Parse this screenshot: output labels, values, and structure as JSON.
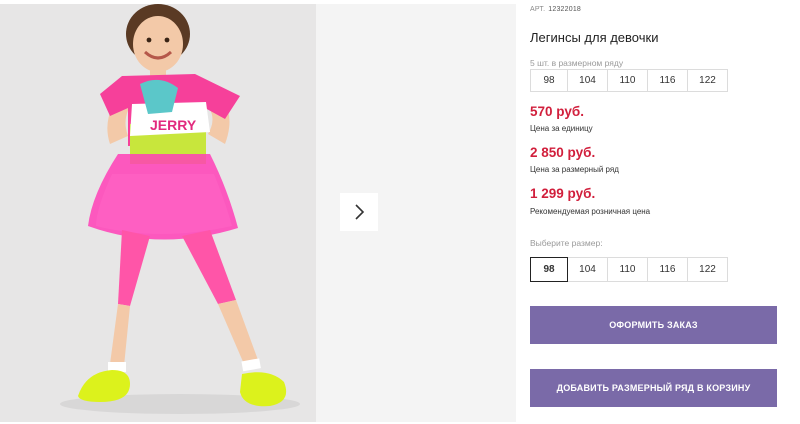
{
  "product": {
    "article_label": "АРТ.",
    "article_number": "12322018",
    "title": "Легинсы для девочки",
    "series_hint": "5 шт. в размерном ряду",
    "series_sizes": [
      "98",
      "104",
      "110",
      "116",
      "122"
    ]
  },
  "prices": {
    "unit_price": "570 руб.",
    "unit_note": "Цена за единицу",
    "series_price": "2 850 руб.",
    "series_note": "Цена за размерный ряд",
    "retail_price": "1 299 руб.",
    "retail_note": "Рекомендуемая розничная цена"
  },
  "size_select": {
    "label": "Выберите размер:",
    "options": [
      "98",
      "104",
      "110",
      "116",
      "122"
    ],
    "selected": "98"
  },
  "actions": {
    "order_label": "ОФОРМИТЬ ЗАКАЗ",
    "add_series_label": "ДОБАВИТЬ РАЗМЕРНЫЙ РЯД В КОРЗИНУ"
  },
  "gallery": {
    "next_icon": "chevron-right-icon"
  },
  "colors": {
    "accent_button": "#7a6aa8",
    "price": "#d11f3c"
  }
}
